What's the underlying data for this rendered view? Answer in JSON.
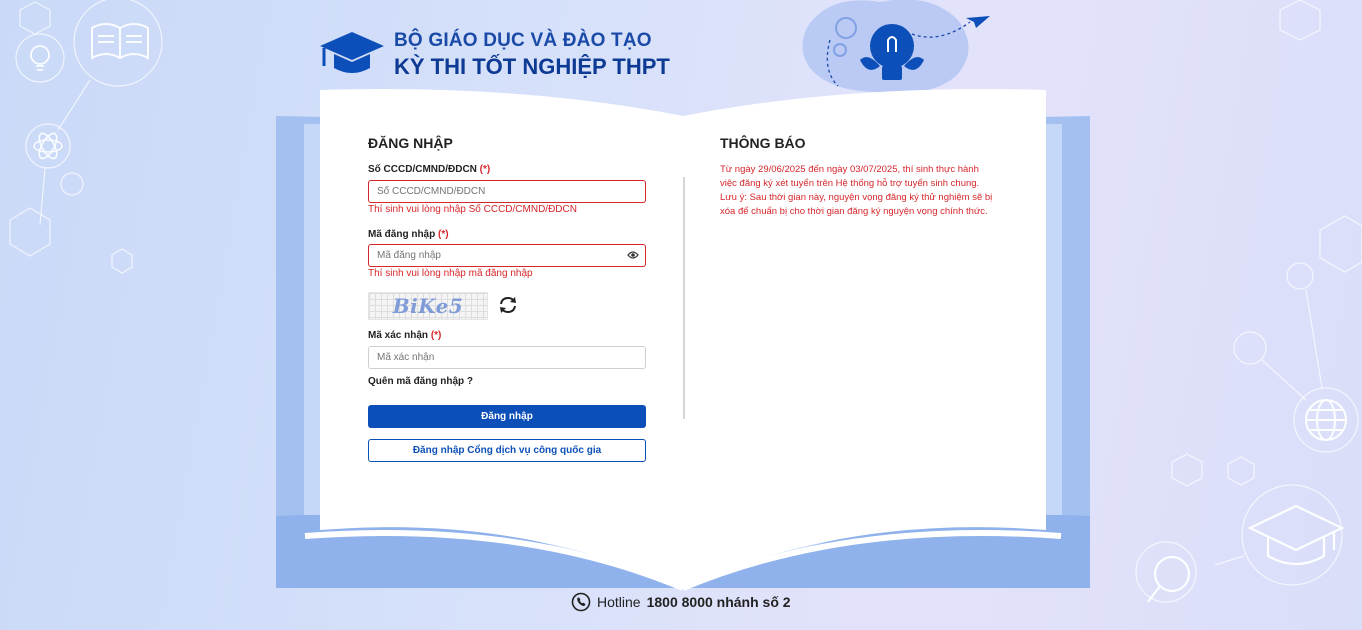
{
  "header": {
    "line1": "BỘ GIÁO DỤC VÀ ĐÀO TẠO",
    "line2": "KỲ THI TỐT NGHIỆP THPT"
  },
  "login": {
    "title": "ĐĂNG NHẬP",
    "id_label": "Số CCCD/CMND/ĐDCN",
    "required_mark": "(*)",
    "id_placeholder": "Số CCCD/CMND/ĐDCN",
    "id_error": "Thí sinh vui lòng nhập Số CCCD/CMND/ĐDCN",
    "code_label": "Mã đăng nhập",
    "code_placeholder": "Mã đăng nhập",
    "code_error": "Thí sinh vui lòng nhập mã đăng nhập",
    "captcha_text": "BiKe5",
    "verify_label": "Mã xác nhận",
    "verify_placeholder": "Mã xác nhận",
    "forgot_link": "Quên mã đăng nhập ?",
    "login_button": "Đăng nhập",
    "national_portal_button": "Đăng nhập Cổng dịch vụ công quốc gia"
  },
  "notice": {
    "title": "THÔNG BÁO",
    "paragraph1": "Từ ngày 29/06/2025 đến ngày 03/07/2025, thí sinh thực hành việc đăng ký xét tuyển trên Hệ thống hỗ trợ tuyển sinh chung.",
    "paragraph2": "Lưu ý: Sau thời gian này, nguyện vọng đăng ký thử nghiệm sẽ bị xóa để chuẩn bị cho thời gian đăng ký nguyện vọng chính thức."
  },
  "footer": {
    "hotline_label": "Hotline",
    "hotline_number": "1800 8000 nhánh số 2"
  },
  "colors": {
    "primary": "#0d4fb8",
    "error": "#d6262b",
    "heading": "#1a4aa8"
  }
}
